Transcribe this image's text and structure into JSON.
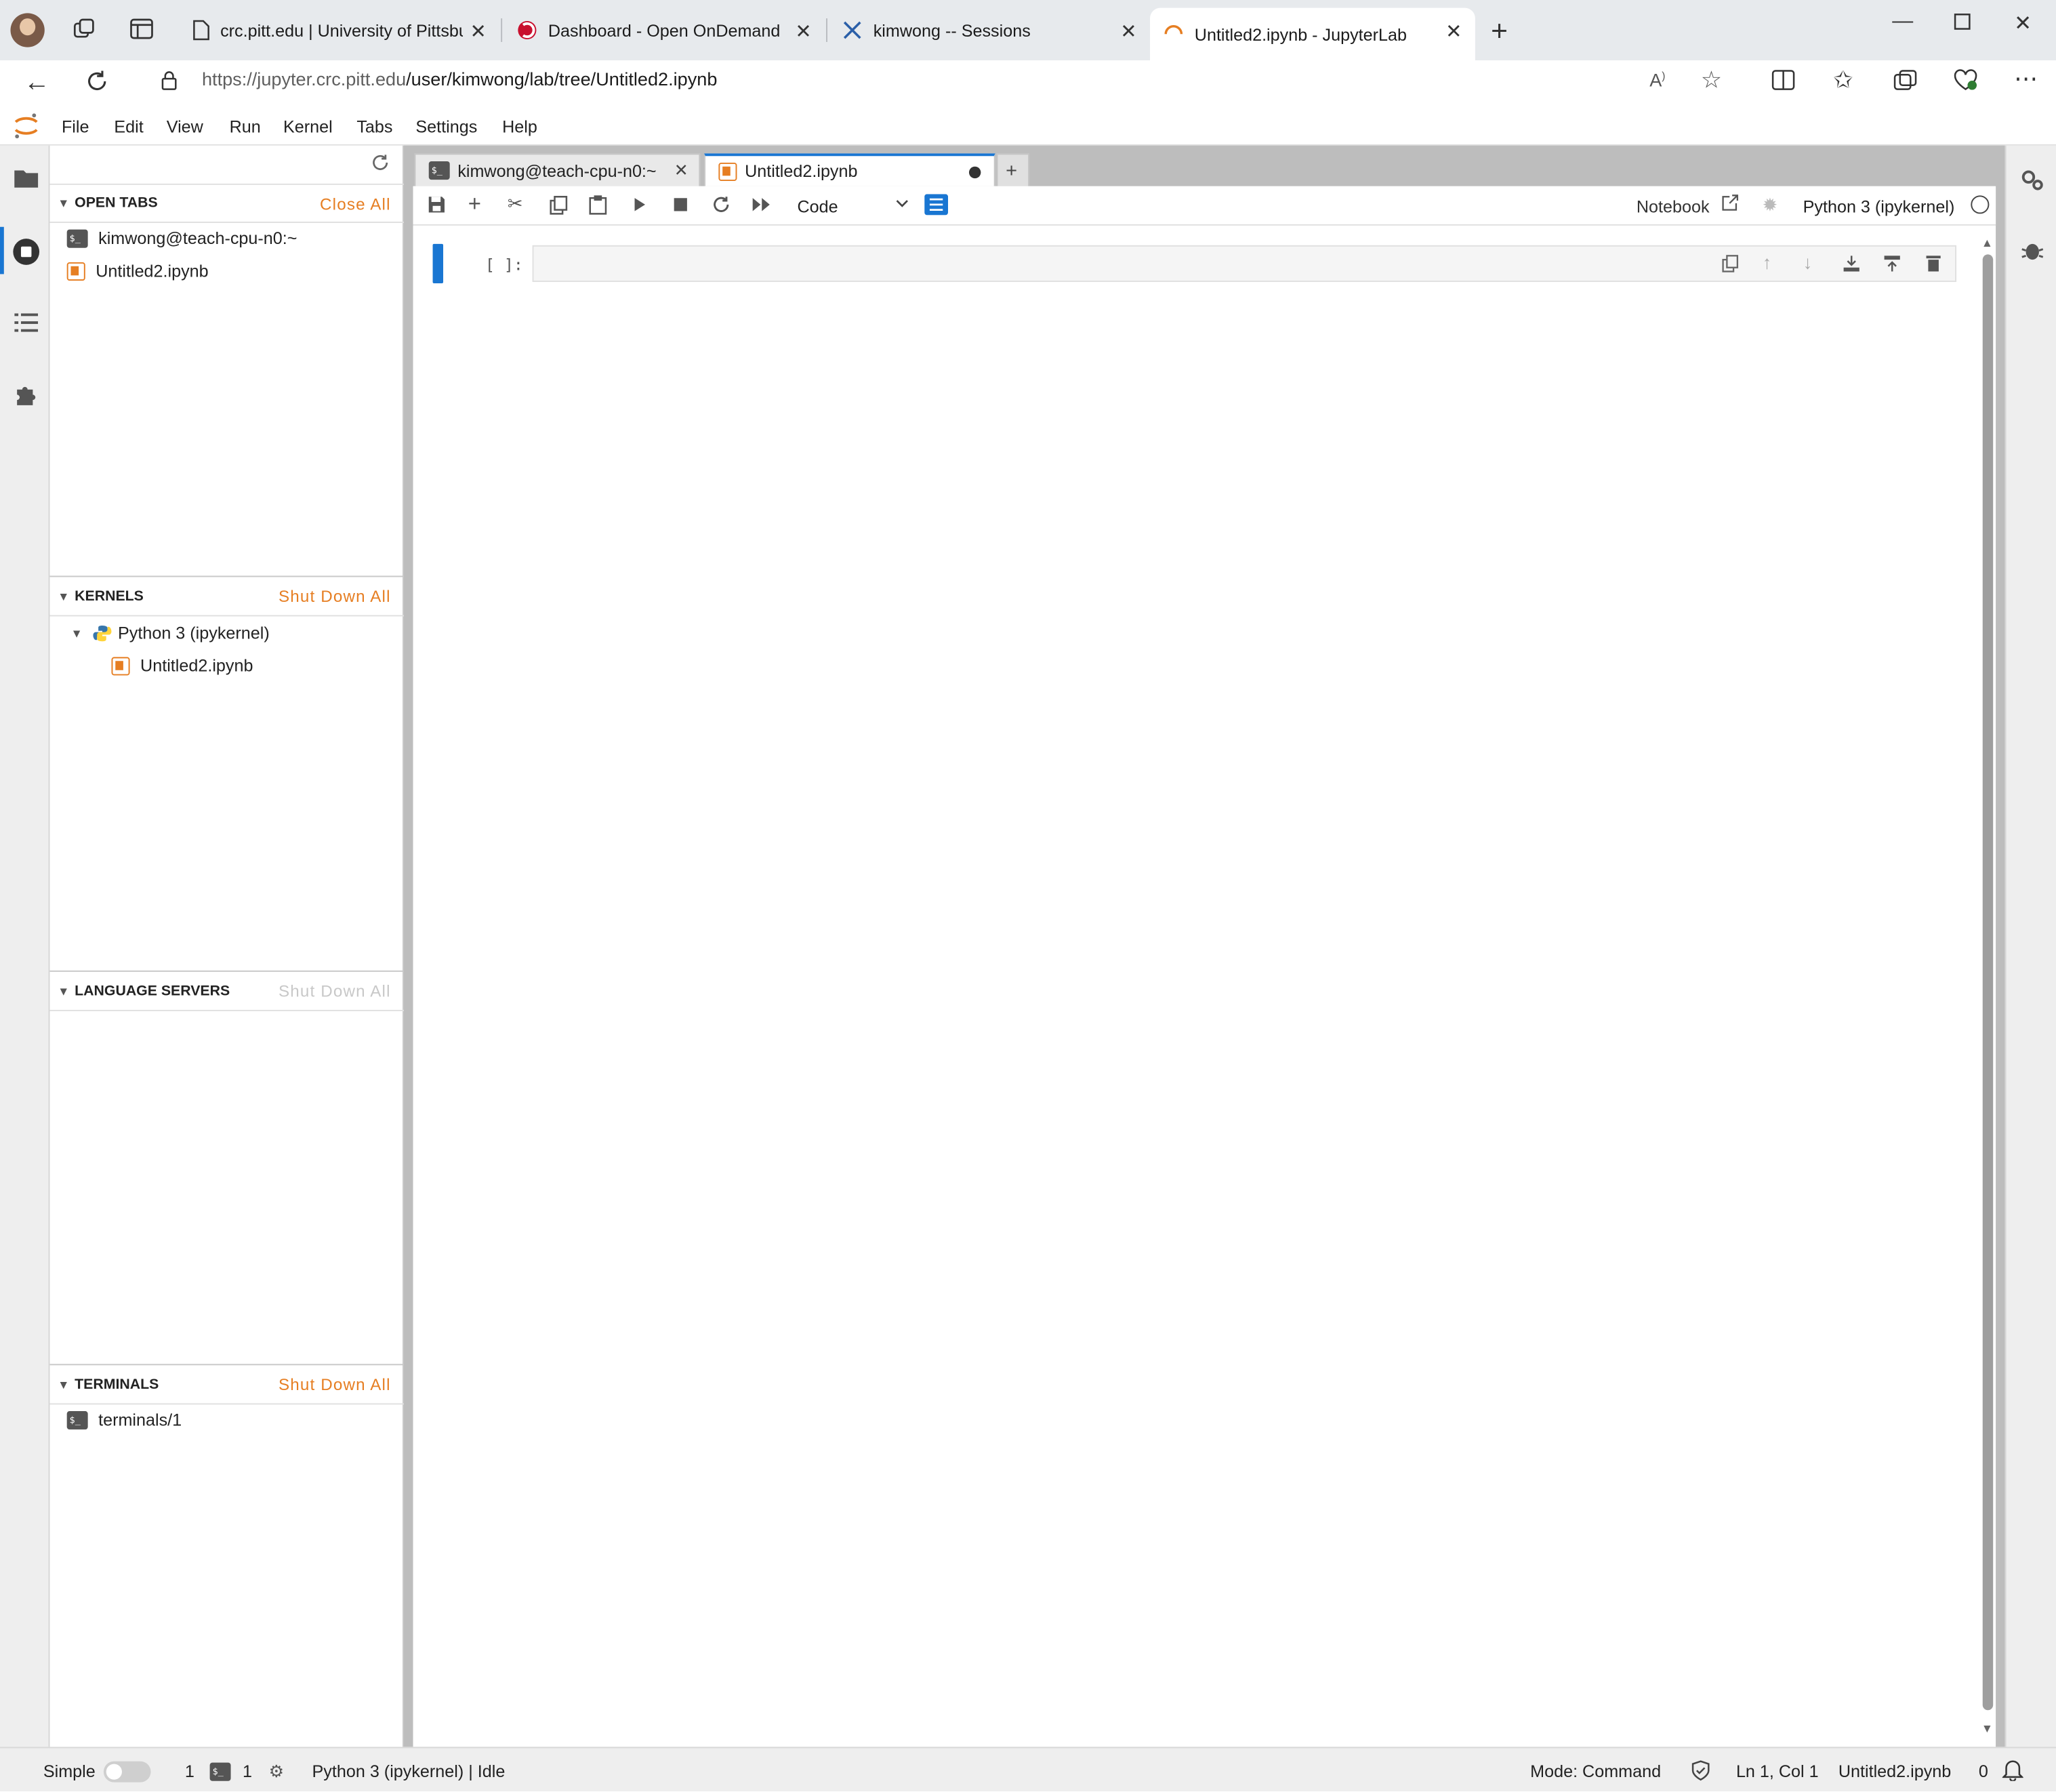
{
  "browser": {
    "tabs": [
      {
        "title": "crc.pitt.edu | University of Pittsbur",
        "icon": "page-icon"
      },
      {
        "title": "Dashboard - Open OnDemand",
        "icon": "ondemand-logo-icon"
      },
      {
        "title": "kimwong -- Sessions",
        "icon": "xterm-logo-icon"
      },
      {
        "title": "Untitled2.ipynb - JupyterLab",
        "icon": "jupyter-loading-icon"
      }
    ],
    "url_host": "https://jupyter.crc.pitt.edu",
    "url_path": "/user/kimwong/lab/tree/Untitled2.ipynb"
  },
  "menu": [
    "File",
    "Edit",
    "View",
    "Run",
    "Kernel",
    "Tabs",
    "Settings",
    "Help"
  ],
  "sidebar": {
    "open_tabs": {
      "header": "OPEN TABS",
      "action": "Close All",
      "items": [
        "kimwong@teach-cpu-n0:~",
        "Untitled2.ipynb"
      ]
    },
    "kernels": {
      "header": "KERNELS",
      "action": "Shut Down All",
      "kernel": "Python 3 (ipykernel)",
      "notebook": "Untitled2.ipynb"
    },
    "language_servers": {
      "header": "LANGUAGE SERVERS",
      "action": "Shut Down All"
    },
    "terminals": {
      "header": "TERMINALS",
      "action": "Shut Down All",
      "items": [
        "terminals/1"
      ]
    }
  },
  "doc_tabs": [
    "kimwong@teach-cpu-n0:~",
    "Untitled2.ipynb"
  ],
  "notebook": {
    "cell_type": "Code",
    "notebook_label": "Notebook",
    "kernel_name": "Python 3 (ipykernel)",
    "prompt": "[ ]:"
  },
  "status": {
    "simple": "Simple",
    "count1": "1",
    "count2": "1",
    "kernel_status": "Python 3 (ipykernel) | Idle",
    "mode": "Mode: Command",
    "position": "Ln 1, Col 1",
    "file": "Untitled2.ipynb",
    "notifications": "0"
  },
  "colors": {
    "accent": "#1976d2",
    "jupyter_orange": "#e67e22"
  }
}
